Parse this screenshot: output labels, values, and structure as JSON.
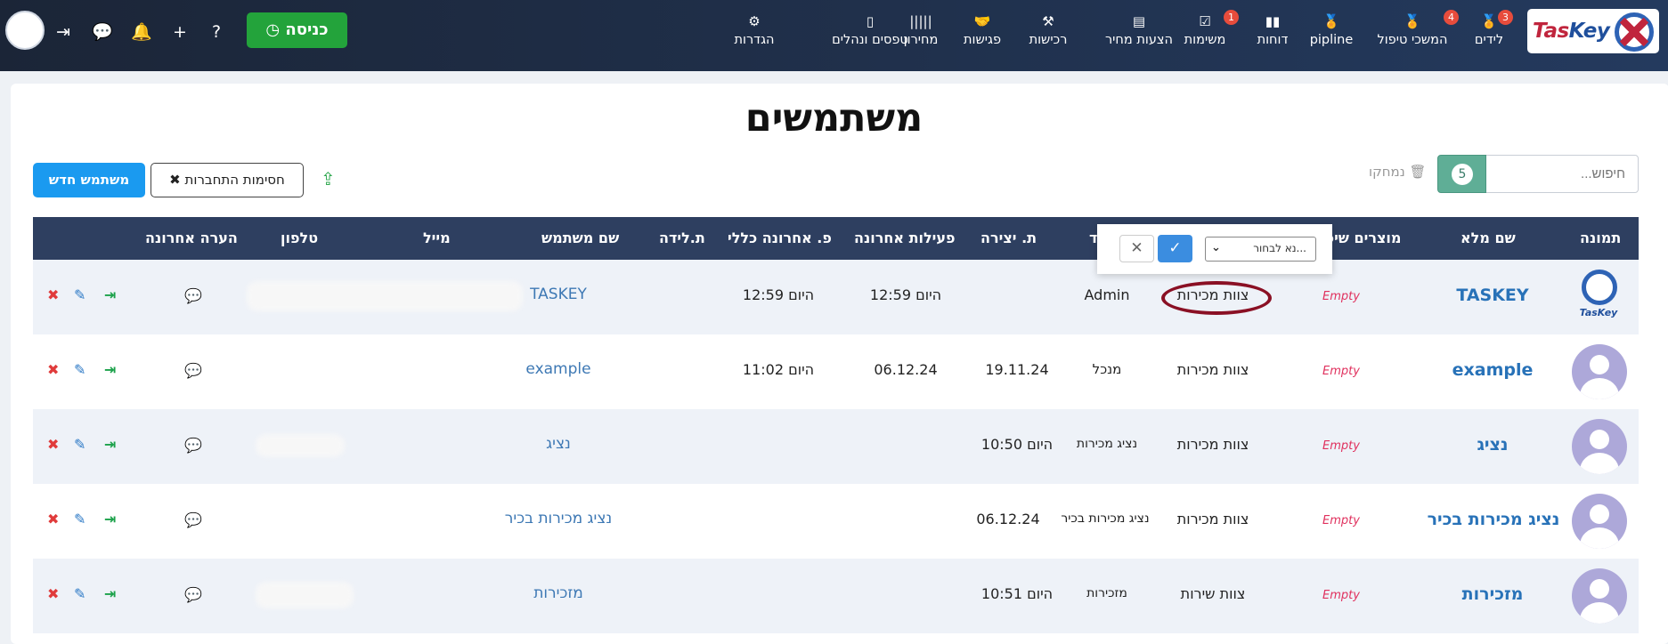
{
  "app": {
    "brand": "TasKey",
    "brand_accent": "#c0253d",
    "brand_color": "#1f4f9c"
  },
  "topnav": {
    "items": [
      {
        "key": "leads",
        "label": "לידים",
        "icon": "leads-icon",
        "badge": "3"
      },
      {
        "key": "followups",
        "label": "המשכי טיפול",
        "icon": "followups-icon",
        "badge": "4"
      },
      {
        "key": "pipeline",
        "label": "pipline",
        "icon": "pipeline-icon",
        "badge": ""
      },
      {
        "key": "reports",
        "label": "דוחות",
        "icon": "bar-chart-icon",
        "badge": ""
      },
      {
        "key": "tasks",
        "label": "משימות",
        "icon": "checkbox-icon",
        "badge": "1"
      },
      {
        "key": "quotes",
        "label": "הצעות מחיר",
        "icon": "quote-icon",
        "badge": ""
      },
      {
        "key": "purchases",
        "label": "רכישות",
        "icon": "purchases-icon",
        "badge": ""
      },
      {
        "key": "meetings",
        "label": "פגישות",
        "icon": "handshake-icon",
        "badge": ""
      },
      {
        "key": "pricelist",
        "label": "מחירון",
        "icon": "barcode-icon",
        "badge": ""
      },
      {
        "key": "forms",
        "label": "טפסים ונהלים",
        "icon": "forms-icon",
        "badge": ""
      },
      {
        "key": "settings",
        "label": "הגדרות",
        "icon": "gear-icon",
        "badge": ""
      }
    ],
    "enter_label": "כניסה"
  },
  "page": {
    "title": "משתמשים",
    "search_placeholder": "חיפוש...",
    "count": "5",
    "deleted_label": "נמחקו",
    "new_user_label": "משתמש חדש",
    "block_label": "חסימות התחברות"
  },
  "table": {
    "headers": {
      "pic": "תמונה",
      "fullname": "שם מלא",
      "products": "מוצרים שיכ",
      "role": "ד",
      "created": "ת. יצירה",
      "last_activity": "פעילות אחרונה",
      "last_login": "פ. אחרונה כללי",
      "birth": "ת.לידה",
      "username": "שם משתמש",
      "email": "מייל",
      "phone": "טלפון",
      "last_note": "הערה אחרונה"
    },
    "rows": [
      {
        "fullname": "TASKEY",
        "products": "Empty",
        "team": "צוות מכירות",
        "role": "Admin",
        "created": "",
        "last_activity": "היום 12:59",
        "last_login": "היום 12:59",
        "birth": "",
        "username": "TASKEY",
        "pic": "logo"
      },
      {
        "fullname": "example",
        "products": "Empty",
        "team": "צוות מכירות",
        "role": "מנכל",
        "created": "19.11.24",
        "last_activity": "06.12.24",
        "last_login": "היום 11:02",
        "birth": "",
        "username": "example",
        "pic": "avatar"
      },
      {
        "fullname": "נציג",
        "products": "Empty",
        "team": "צוות מכירות",
        "role": "נציג מכירות",
        "created": "היום 10:50",
        "last_activity": "",
        "last_login": "",
        "birth": "",
        "username": "נציג",
        "pic": "avatar"
      },
      {
        "fullname": "נציג מכירות בכיר",
        "products": "Empty",
        "team": "צוות מכירות",
        "role": "נציג מכירות בכיר",
        "created": "06.12.24",
        "last_activity": "",
        "last_login": "",
        "birth": "",
        "username": "נציג מכירות בכיר",
        "pic": "avatar"
      },
      {
        "fullname": "מזכירות",
        "products": "Empty",
        "team": "צוות שירות",
        "role": "מזכירות",
        "created": "היום 10:51",
        "last_activity": "",
        "last_login": "",
        "birth": "",
        "username": "מזכירות",
        "pic": "avatar"
      }
    ]
  },
  "popup": {
    "select_placeholder": "נא לבחור..."
  }
}
